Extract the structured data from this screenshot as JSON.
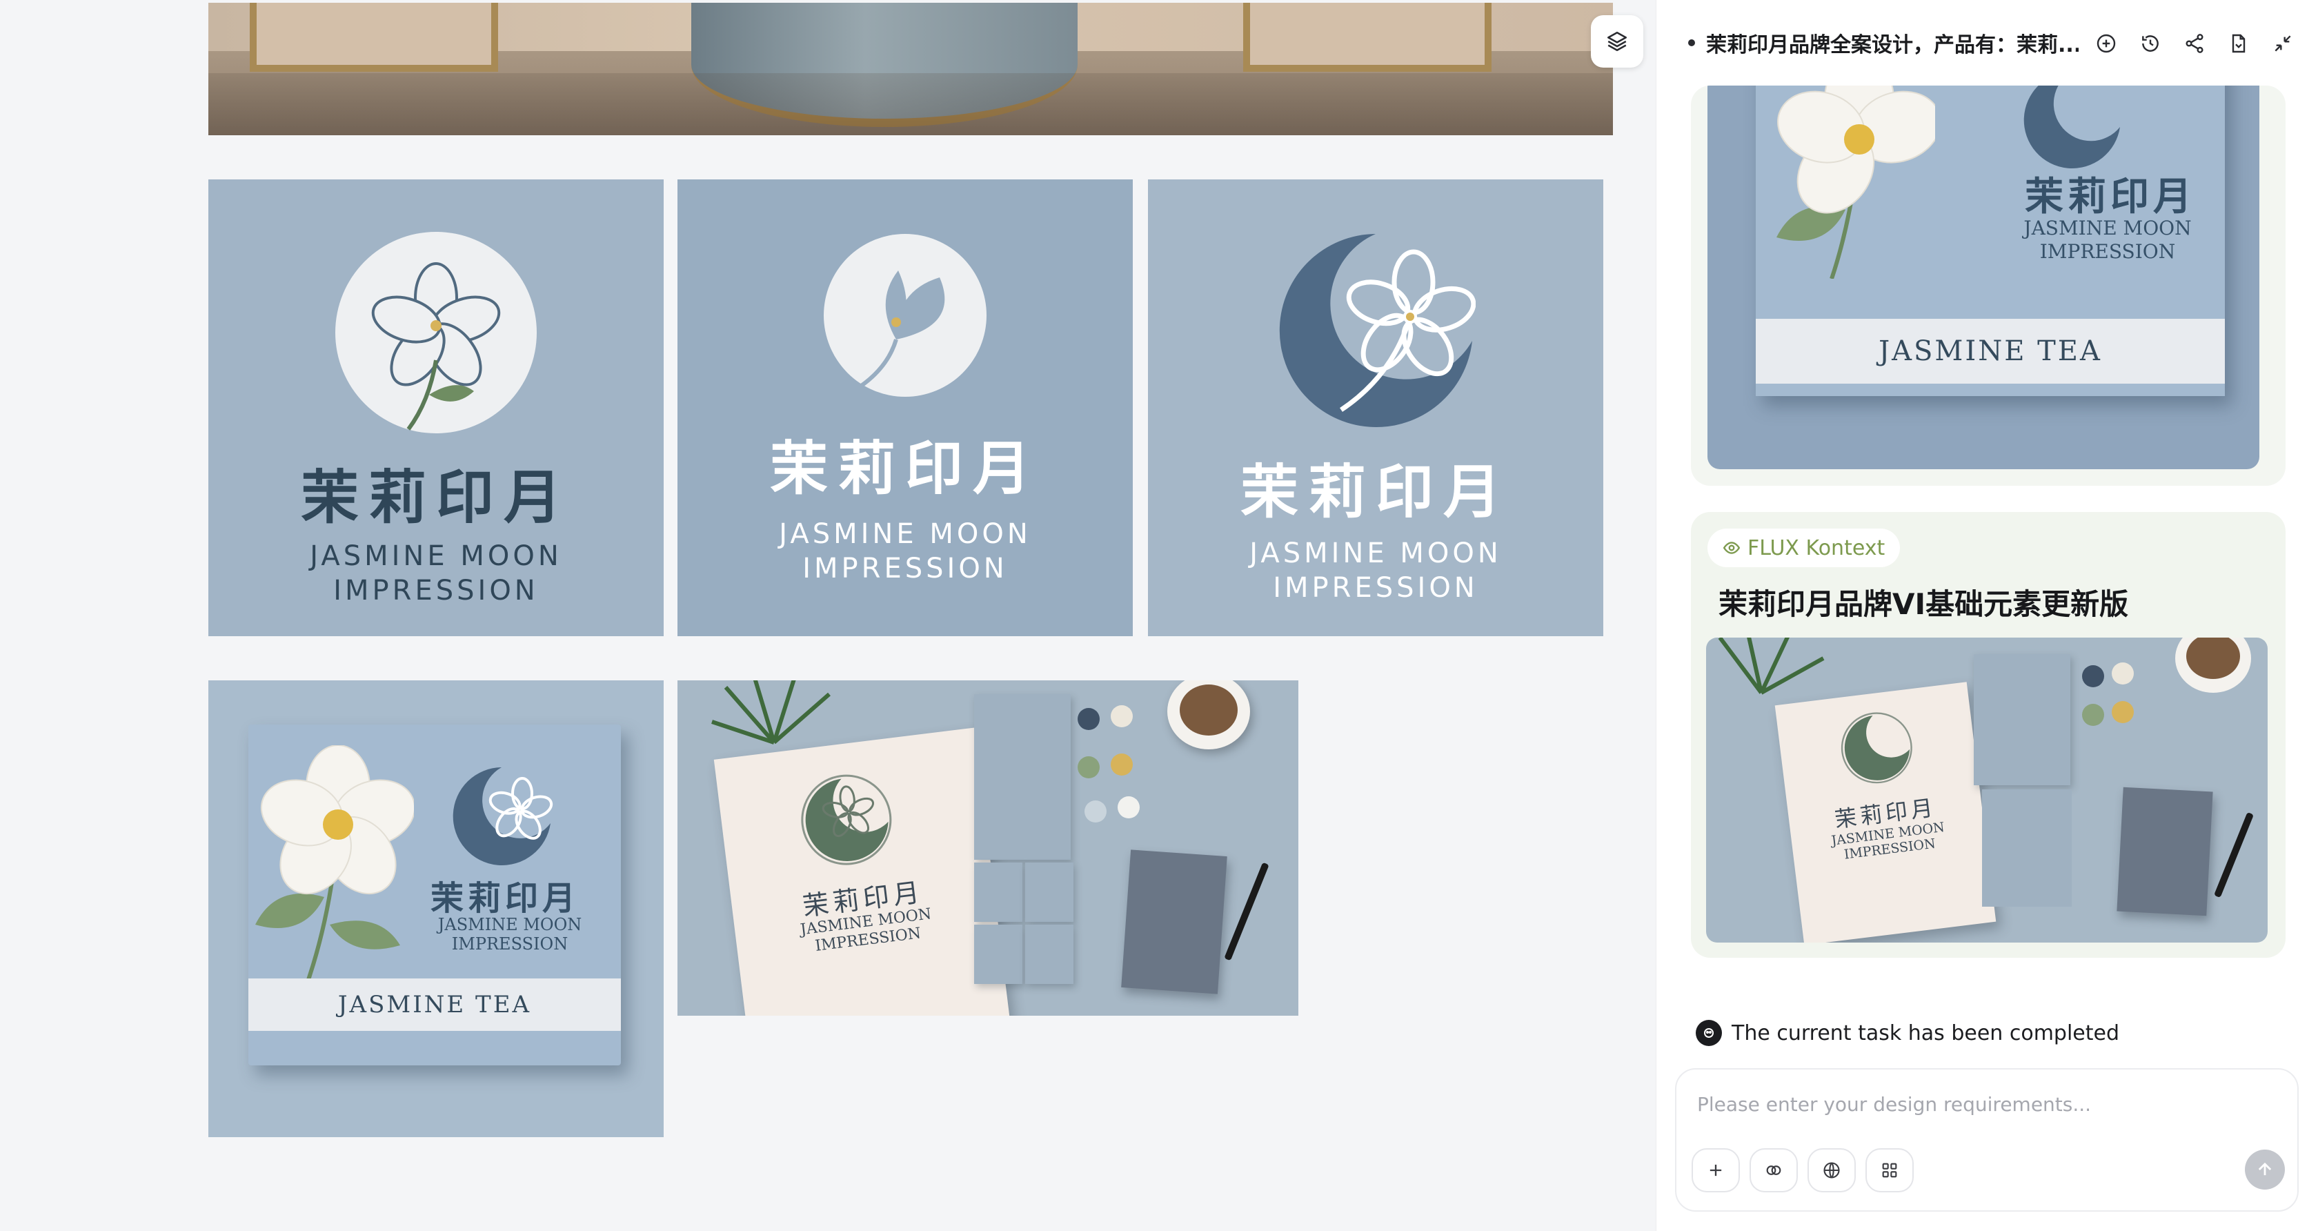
{
  "panel": {
    "header_title": "茉莉印月品牌全案设计，产品有：茉莉...",
    "messages": [
      {
        "badge": "FLUX Kontext",
        "title": "茉莉印月品牌VI基础元素更新版"
      }
    ],
    "status_text": "The current task has been completed",
    "input_placeholder": "Please enter your design requirements..."
  },
  "logos": [
    {
      "cn": "茉莉印月",
      "en_line1": "JASMINE MOON",
      "en_line2": "IMPRESSION"
    },
    {
      "cn": "茉莉印月",
      "en_line1": "JASMINE MOON",
      "en_line2": "IMPRESSION"
    },
    {
      "cn": "茉莉印月",
      "en_line1": "JASMINE MOON",
      "en_line2": "IMPRESSION"
    }
  ],
  "tea_box": {
    "cn": "茉莉印月",
    "en_line1": "JASMINE MOON",
    "en_line2": "IMPRESSION",
    "band": "JASMINE TEA"
  },
  "mockup": {
    "cn": "茉莉印月",
    "en_line1": "JASMINE MOON",
    "en_line2": "IMPRESSION"
  },
  "colors": {
    "tile_bg": "#a1b4c6",
    "navy": "#355068",
    "accent_green": "#7d9a4e"
  }
}
